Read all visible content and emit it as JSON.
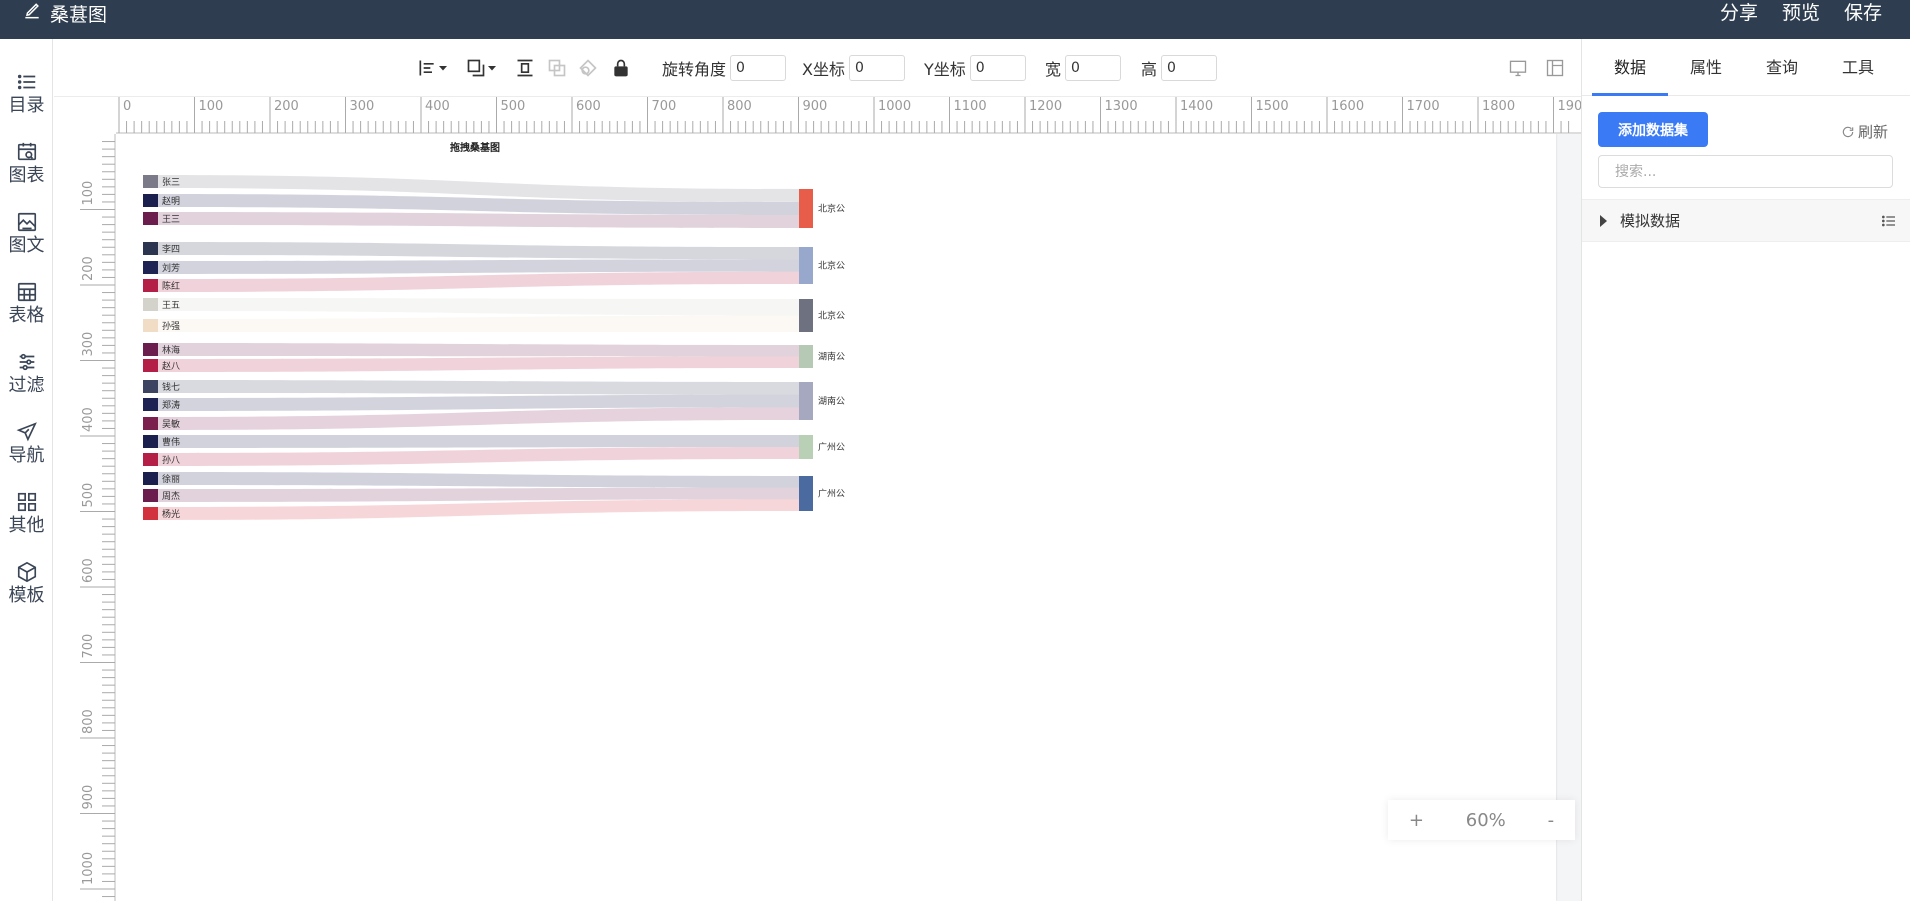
{
  "app": {
    "title": "桑葚图",
    "actions": [
      "分享",
      "预览",
      "保存"
    ]
  },
  "sidebar": {
    "items": [
      {
        "label": "目录",
        "icon": "list-icon"
      },
      {
        "label": "图表",
        "icon": "chart-icon"
      },
      {
        "label": "图文",
        "icon": "image-text-icon"
      },
      {
        "label": "表格",
        "icon": "table-icon"
      },
      {
        "label": "过滤",
        "icon": "filter-icon"
      },
      {
        "label": "导航",
        "icon": "navigation-icon"
      },
      {
        "label": "其他",
        "icon": "grid-icon"
      },
      {
        "label": "模板",
        "icon": "template-icon"
      }
    ]
  },
  "toolbar": {
    "rotation_label": "旋转角度",
    "rotation_value": "0",
    "x_label": "X坐标",
    "x_value": "0",
    "y_label": "Y坐标",
    "y_value": "0",
    "width_label": "宽",
    "width_value": "0",
    "height_label": "高",
    "height_value": "0"
  },
  "rulers": {
    "top": [
      "0",
      "100",
      "200",
      "300",
      "400",
      "500",
      "600",
      "700",
      "800",
      "900",
      "1000",
      "1100",
      "1200",
      "1300",
      "1400",
      "1500",
      "1600",
      "1700",
      "1800",
      "1900"
    ],
    "left": [
      "100",
      "200",
      "300",
      "400",
      "500",
      "600",
      "700",
      "800",
      "900",
      "1000"
    ]
  },
  "canvas": {
    "zoom": "60%",
    "zoom_in": "+",
    "zoom_out": "-"
  },
  "chart_data": {
    "type": "sankey",
    "title": "拖拽桑基图",
    "sources": [
      {
        "name": "张三",
        "color": "#7a7a88"
      },
      {
        "name": "赵明",
        "color": "#1a1f4e"
      },
      {
        "name": "王三",
        "color": "#6b1e4e"
      },
      {
        "name": "李四",
        "color": "#2c3550"
      },
      {
        "name": "刘芳",
        "color": "#1e2354"
      },
      {
        "name": "陈红",
        "color": "#b41f48"
      },
      {
        "name": "王五",
        "color": "#d3d3cc"
      },
      {
        "name": "孙强",
        "color": "#f1dcc6"
      },
      {
        "name": "林海",
        "color": "#6b1e4e"
      },
      {
        "name": "赵八",
        "color": "#b41f48"
      },
      {
        "name": "钱七",
        "color": "#3c4462"
      },
      {
        "name": "郑涛",
        "color": "#1e2354"
      },
      {
        "name": "吴敏",
        "color": "#7b1f4f"
      },
      {
        "name": "曹伟",
        "color": "#1a1f4e"
      },
      {
        "name": "孙八",
        "color": "#b41f48"
      },
      {
        "name": "徐丽",
        "color": "#1a1f4e"
      },
      {
        "name": "周杰",
        "color": "#6b1e4e"
      },
      {
        "name": "杨光",
        "color": "#d2323e"
      }
    ],
    "targets": [
      {
        "name": "北京公",
        "color": "#e85c4a"
      },
      {
        "name": "北京公",
        "color": "#97a8cc"
      },
      {
        "name": "北京公",
        "color": "#6e7280"
      },
      {
        "name": "湖南公",
        "color": "#b6c9b5"
      },
      {
        "name": "湖南公",
        "color": "#a6a8c0"
      },
      {
        "name": "广州公",
        "color": "#b9d0b6"
      },
      {
        "name": "广州公",
        "color": "#4b6aa0"
      }
    ],
    "links": [
      {
        "source": 0,
        "target": 0,
        "value": 1
      },
      {
        "source": 1,
        "target": 0,
        "value": 1
      },
      {
        "source": 2,
        "target": 0,
        "value": 1
      },
      {
        "source": 3,
        "target": 1,
        "value": 1
      },
      {
        "source": 4,
        "target": 1,
        "value": 1
      },
      {
        "source": 5,
        "target": 1,
        "value": 1
      },
      {
        "source": 6,
        "target": 2,
        "value": 1
      },
      {
        "source": 7,
        "target": 2,
        "value": 1
      },
      {
        "source": 8,
        "target": 3,
        "value": 1
      },
      {
        "source": 9,
        "target": 3,
        "value": 1
      },
      {
        "source": 10,
        "target": 4,
        "value": 1
      },
      {
        "source": 11,
        "target": 4,
        "value": 1
      },
      {
        "source": 12,
        "target": 4,
        "value": 1
      },
      {
        "source": 13,
        "target": 5,
        "value": 1
      },
      {
        "source": 14,
        "target": 5,
        "value": 1
      },
      {
        "source": 15,
        "target": 6,
        "value": 1
      },
      {
        "source": 16,
        "target": 6,
        "value": 1
      },
      {
        "source": 17,
        "target": 6,
        "value": 1
      }
    ]
  },
  "panel": {
    "tabs": [
      "数据",
      "属性",
      "查询",
      "工具"
    ],
    "add_dataset": "添加数据集",
    "refresh": "刷新",
    "search_placeholder": "搜索...",
    "dataset_name": "模拟数据"
  }
}
